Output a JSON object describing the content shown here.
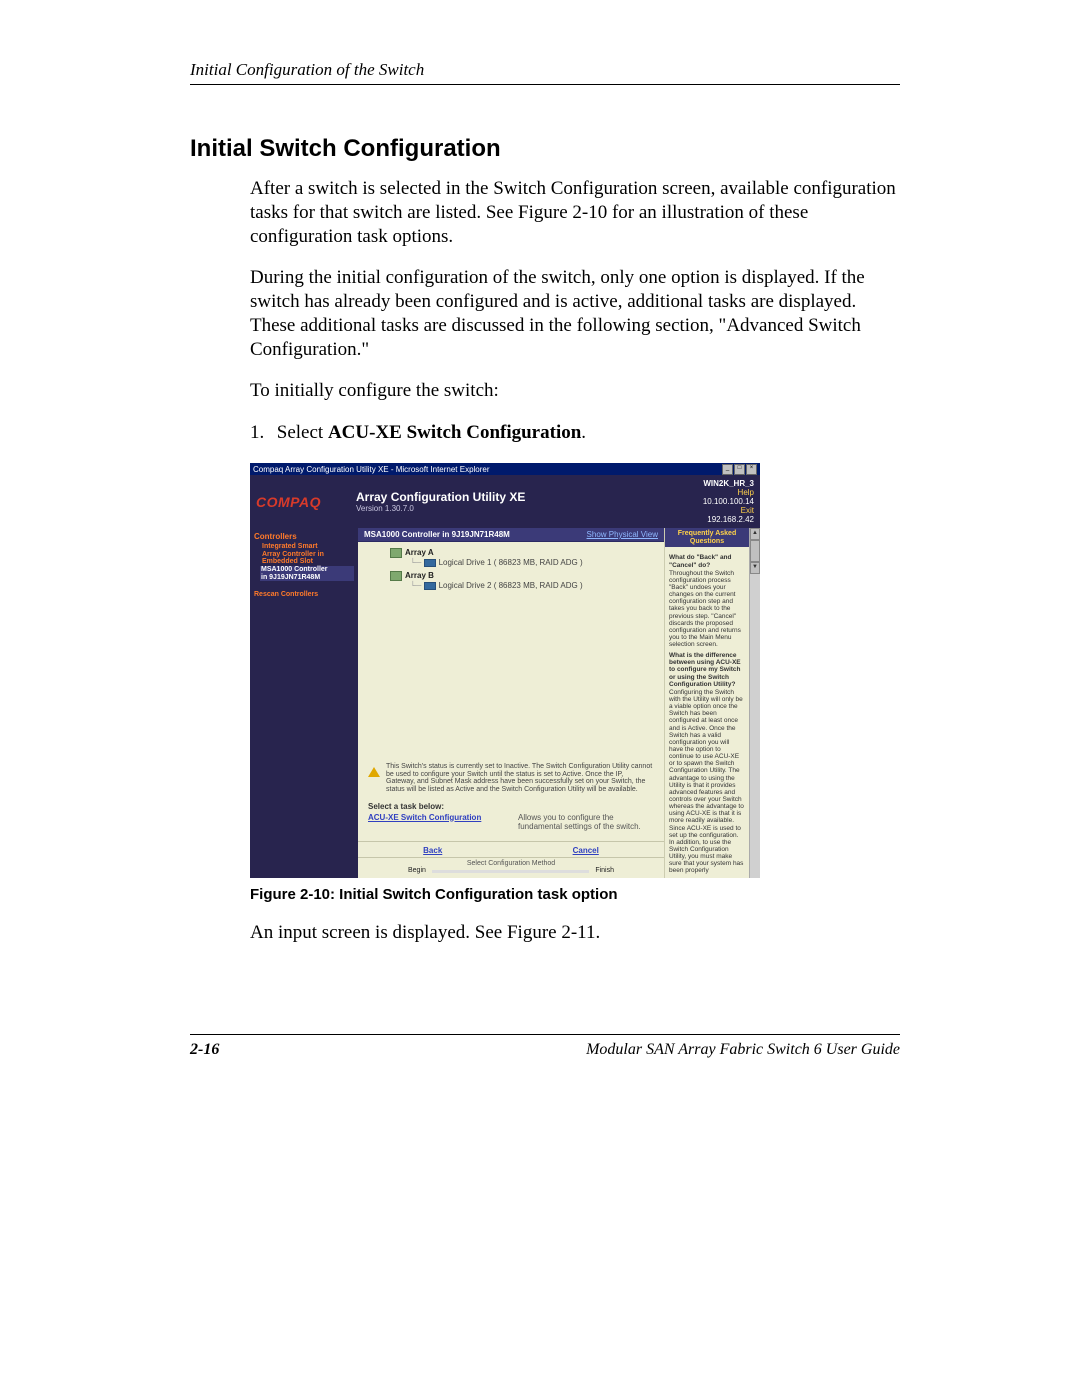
{
  "header": {
    "chapter_title": "Initial Configuration of the Switch"
  },
  "section": {
    "title": "Initial Switch Configuration"
  },
  "para1": "After a switch is selected in the Switch Configuration screen, available configuration tasks for that switch are listed. See Figure 2-10 for an illustration of these configuration task options.",
  "para2": "During the initial configuration of the switch, only one option is displayed. If the switch has already been configured and is active, additional tasks are displayed. These additional tasks are discussed in the following section, \"Advanced Switch Configuration.\"",
  "para3": "To initially configure the switch:",
  "step1": {
    "num": "1.",
    "pre": "Select ",
    "bold": "ACU-XE Switch Configuration",
    "post": "."
  },
  "figure": {
    "ie_title": "Compaq Array Configuration Utility XE - Microsoft Internet Explorer",
    "banner": {
      "brand": "COMPAQ",
      "title": "Array Configuration Utility XE",
      "version": "Version 1.30.7.0",
      "host": "WIN2K_HR_3",
      "ip1": "10.100.100.14",
      "ip2": "192.168.2.42",
      "help": "Help",
      "exit": "Exit"
    },
    "sidebar": {
      "hdr": "Controllers",
      "item1a": "Integrated Smart",
      "item1b": "Array Controller in",
      "item1c": "Embedded Slot",
      "item2a": "MSA1000 Controller",
      "item2b": "in 9J19JN71R48M",
      "rescan": "Rescan Controllers"
    },
    "panel": {
      "title": "MSA1000 Controller in 9J19JN71R48M",
      "link": "Show Physical View",
      "arrA": "Array A",
      "ld1": "Logical Drive 1 ( 86823 MB, RAID ADG )",
      "arrB": "Array B",
      "ld2": "Logical Drive 2 ( 86823 MB, RAID ADG )"
    },
    "warn": "This Switch's status is currently set to Inactive. The Switch Configuration Utility cannot be used to configure your Switch until the status is set to Active. Once the IP, Gateway, and Subnet Mask address have been successfully set on your Switch, the status will be listed as Active and the Switch Configuration Utility will be available.",
    "task_hdr": "Select a task below:",
    "task_link": "ACU-XE Switch Configuration",
    "task_desc": "Allows you to configure the fundamental settings of the switch.",
    "nav_back": "Back",
    "nav_cancel": "Cancel",
    "wiz_label": "Select Configuration Method",
    "wiz_begin": "Begin",
    "wiz_finish": "Finish",
    "faq": {
      "hdr": "Frequently Asked Questions",
      "q1": "What do \"Back\" and \"Cancel\" do?",
      "a1": "Throughout the Switch configuration process \"Back\" undoes your changes on the current configuration step and takes you back to the previous step. \"Cancel\" discards the proposed configuration and returns you to the Main Menu selection screen.",
      "q2": "What is the difference between using ACU-XE to configure my Switch or using the Switch Configuration Utility?",
      "a2": "Configuring the Switch with the Utility will only be a viable option once the Switch has been configured at least once and is Active. Once the Switch has a valid configuration you will have the option to continue to use ACU-XE or to spawn the Switch Configuration Utility. The advantage to using the Utility is that it provides advanced features and controls over your Switch whereas the advantage to using ACU-XE is that it is more readily available. Since ACU-XE is used to set up the configuration. In addition, to use the Switch Configuration Utility, you must make sure that your system has been properly"
    }
  },
  "fig_caption": "Figure 2-10:  Initial Switch Configuration task option",
  "after_fig": "An input screen is displayed. See Figure 2-11.",
  "footer": {
    "page": "2-16",
    "doc": "Modular SAN Array Fabric Switch 6 User Guide"
  }
}
